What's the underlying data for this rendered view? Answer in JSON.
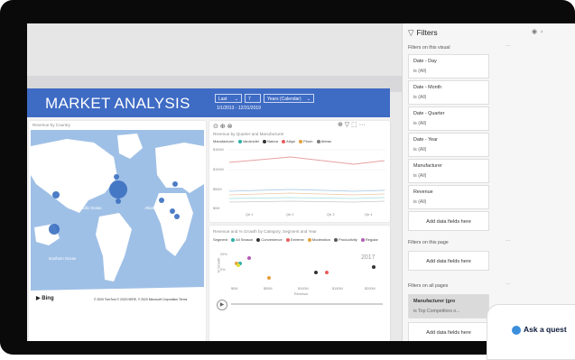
{
  "report": {
    "title": "MARKET ANALYSIS",
    "slicer_last": "Last",
    "slicer_number": "7",
    "slicer_unit": "Years (Calendar)",
    "date_range": "1/1/2013 - 12/31/2019"
  },
  "map_visual": {
    "title": "Revenue by Country",
    "oceans": [
      "Arctic Ocean",
      "North Pacific Ocean",
      "Atlantic Ocean",
      "South Pacific Ocean",
      "Indian Ocean",
      "Southern Ocean"
    ],
    "bing": "Bing",
    "credit": "© 2020 TomTom © 2020 HERE, © 2020 Microsoft Corporation Terms"
  },
  "line_visual": {
    "title": "Revenue by Quarter and Manufacturer",
    "legend_title": "Manufacturer",
    "legend_items": [
      {
        "label": "VanArsdel",
        "color": "#2cb0a6"
      },
      {
        "label": "Natura",
        "color": "#333333"
      },
      {
        "label": "Aliqui",
        "color": "#e85c5c"
      },
      {
        "label": "Pirum",
        "color": "#e3a13b"
      },
      {
        "label": "Abbas",
        "color": "#7c7c7c"
      }
    ],
    "y_ticks": [
      "$150M",
      "$100M",
      "$50M",
      "$0M"
    ],
    "x_ticks": [
      "Qtr 1",
      "Qtr 2",
      "Qtr 3",
      "Qtr 4"
    ]
  },
  "scatter_visual": {
    "title": "Revenue and % Growth by Category, Segment and Year",
    "legend_title": "Segment",
    "legend_items": [
      {
        "label": "All Season",
        "color": "#2cb0a6"
      },
      {
        "label": "Convenience",
        "color": "#333333"
      },
      {
        "label": "Extreme",
        "color": "#e85c5c"
      },
      {
        "label": "Moderation",
        "color": "#e3a13b"
      },
      {
        "label": "Productivity",
        "color": "#555555"
      },
      {
        "label": "Regular",
        "color": "#b35bb4"
      }
    ],
    "year_label": "2017",
    "y_ticks": [
      "20%",
      "0%"
    ],
    "x_ticks": [
      "$0M",
      "$50M",
      "$100M",
      "$150M",
      "$200M"
    ],
    "x_title": "Revenue",
    "y_title": "% Growth"
  },
  "filters": {
    "title": "Filters",
    "on_visual_label": "Filters on this visual",
    "visual_cards": [
      {
        "title": "Date - Day",
        "sub": "is (All)"
      },
      {
        "title": "Date - Month",
        "sub": "is (All)"
      },
      {
        "title": "Date - Quarter",
        "sub": "is (All)"
      },
      {
        "title": "Date - Year",
        "sub": "is (All)"
      },
      {
        "title": "Manufacturer",
        "sub": "is (All)"
      },
      {
        "title": "Revenue",
        "sub": "is (All)"
      }
    ],
    "add_fields": "Add data fields here",
    "on_page_label": "Filters on this page",
    "on_all_pages_label": "Filters on all pages",
    "all_pages_card": {
      "title": "Manufacturer (gro",
      "sub": "is Top Competitors o..."
    }
  },
  "ask": {
    "label": "Ask a quest"
  },
  "colors": {
    "header_blue": "#3e6bc4",
    "map_water": "#9fc0e6",
    "map_land": "#ffffff",
    "bubble": "#3a6fc0"
  }
}
